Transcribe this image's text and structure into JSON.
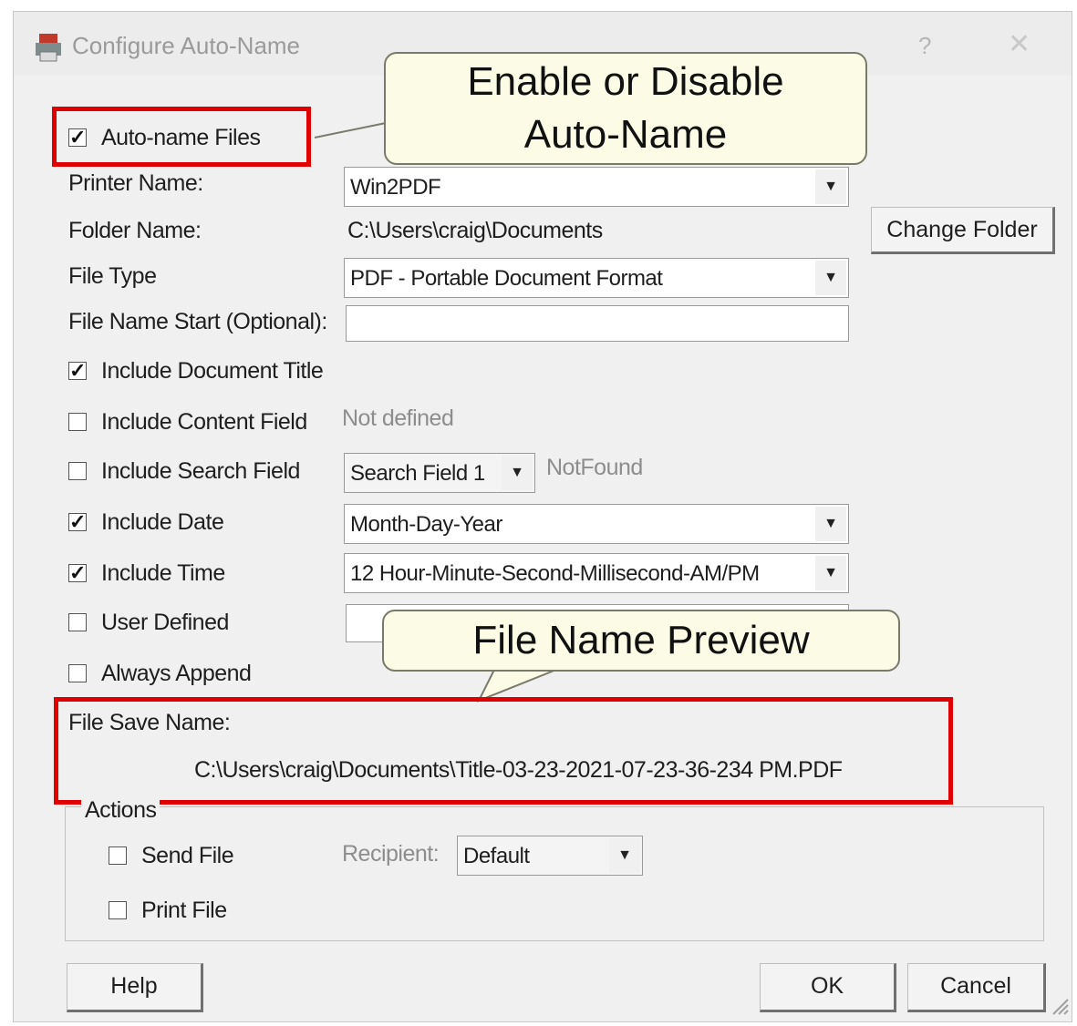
{
  "window": {
    "title": "Configure Auto-Name",
    "help_glyph": "?",
    "close_glyph": "✕",
    "icon": "printer-app-icon"
  },
  "autoname": {
    "label": "Auto-name Files",
    "checked": true
  },
  "printer": {
    "label": "Printer Name:",
    "value": "Win2PDF"
  },
  "folder": {
    "label": "Folder Name:",
    "value": "C:\\Users\\craig\\Documents",
    "change_button": "Change Folder"
  },
  "file_type": {
    "label": "File Type",
    "value": "PDF - Portable Document Format"
  },
  "file_name_start": {
    "label": "File Name Start (Optional):",
    "value": ""
  },
  "options": {
    "doc_title": {
      "label": "Include Document Title",
      "checked": true
    },
    "content_field": {
      "label": "Include Content Field",
      "checked": false,
      "status": "Not defined"
    },
    "search_field": {
      "label": "Include Search Field",
      "checked": false,
      "combo_value": "Search Field 1",
      "status": "NotFound"
    },
    "date": {
      "label": "Include Date",
      "checked": true,
      "value": "Month-Day-Year"
    },
    "time": {
      "label": "Include Time",
      "checked": true,
      "value": "12 Hour-Minute-Second-Millisecond-AM/PM"
    },
    "user_defined": {
      "label": "User Defined",
      "checked": false,
      "value": ""
    },
    "always_append": {
      "label": "Always Append",
      "checked": false
    }
  },
  "save_name": {
    "label": "File Save Name:",
    "value": "C:\\Users\\craig\\Documents\\Title-03-23-2021-07-23-36-234 PM.PDF"
  },
  "actions": {
    "legend": "Actions",
    "send_file": {
      "label": "Send File",
      "checked": false
    },
    "recipient": {
      "label": "Recipient:",
      "value": "Default"
    },
    "print_file": {
      "label": "Print File",
      "checked": false
    }
  },
  "buttons": {
    "help": "Help",
    "ok": "OK",
    "cancel": "Cancel"
  },
  "callouts": {
    "enable_line1": "Enable or Disable",
    "enable_line2": "Auto-Name",
    "preview": "File Name Preview"
  },
  "colors": {
    "highlight": "#e00000",
    "callout_bg": "#fbfbe6",
    "dialog_bg": "#f0f0f0"
  }
}
